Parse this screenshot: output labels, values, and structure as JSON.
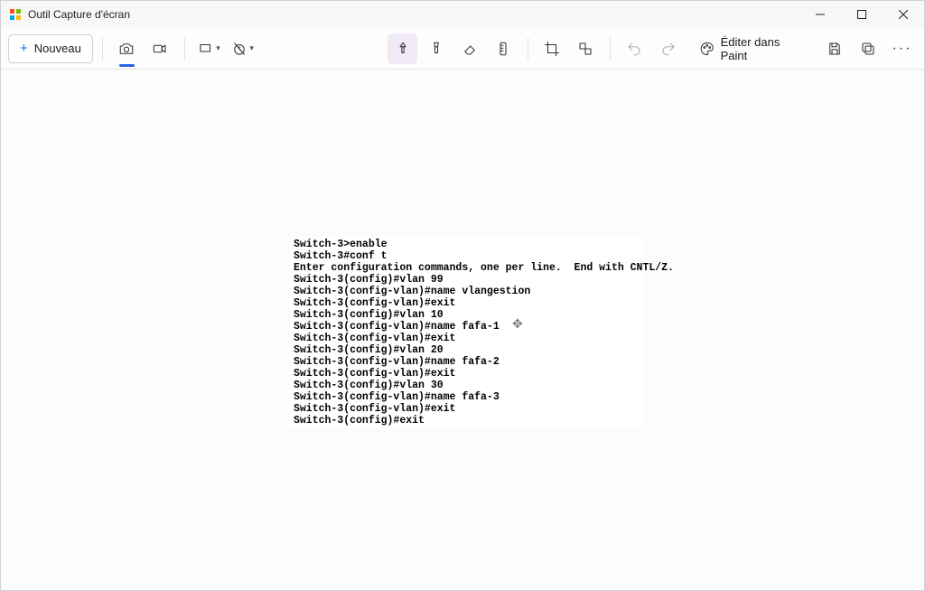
{
  "titlebar": {
    "title": "Outil Capture d'écran"
  },
  "toolbar": {
    "new_label": "Nouveau",
    "edit_paint_label": "Éditer dans Paint"
  },
  "terminal": {
    "lines": [
      "Switch-3>enable",
      "Switch-3#conf t",
      "Enter configuration commands, one per line.  End with CNTL/Z.",
      "Switch-3(config)#vlan 99",
      "Switch-3(config-vlan)#name vlangestion",
      "Switch-3(config-vlan)#exit",
      "Switch-3(config)#vlan 10",
      "Switch-3(config-vlan)#name fafa-1",
      "Switch-3(config-vlan)#exit",
      "Switch-3(config)#vlan 20",
      "Switch-3(config-vlan)#name fafa-2",
      "Switch-3(config-vlan)#exit",
      "Switch-3(config)#vlan 30",
      "Switch-3(config-vlan)#name fafa-3",
      "Switch-3(config-vlan)#exit",
      "Switch-3(config)#exit"
    ]
  }
}
